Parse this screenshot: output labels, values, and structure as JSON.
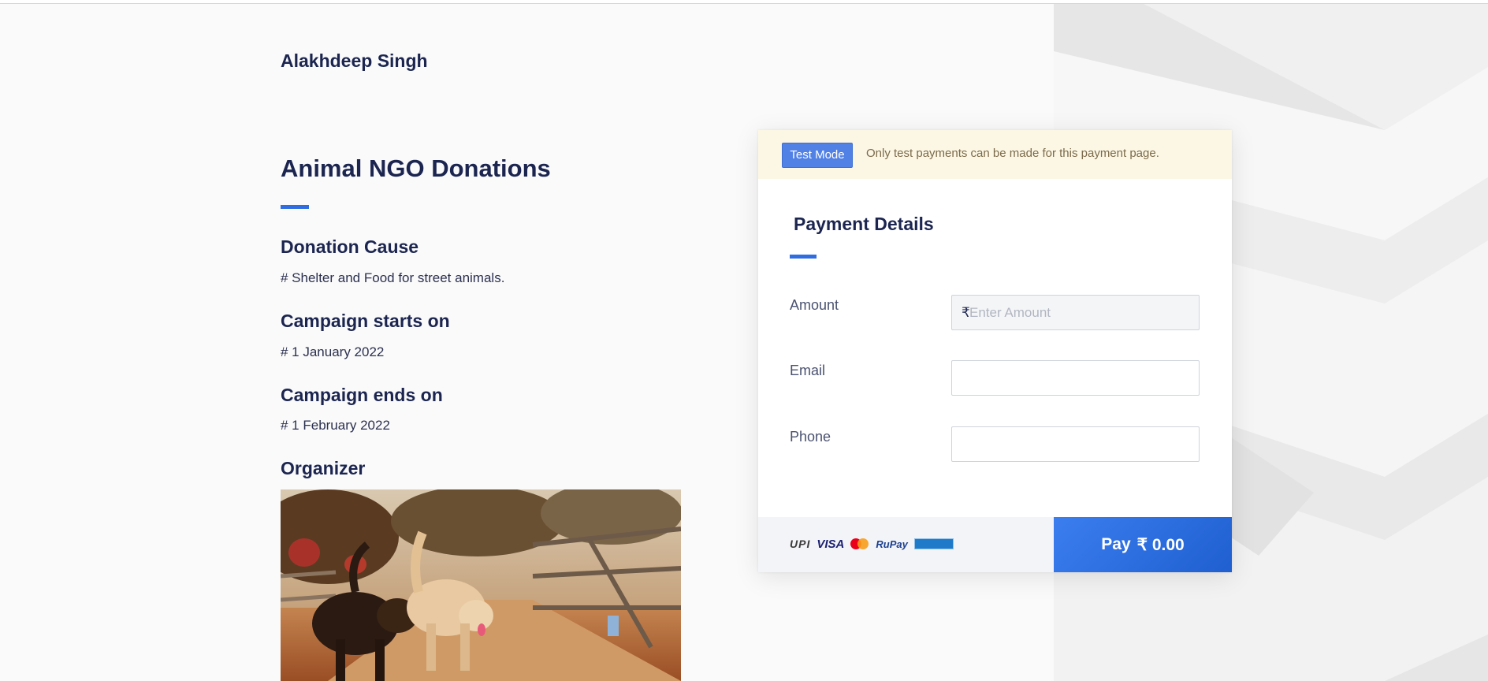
{
  "merchant_name": "Alakhdeep Singh",
  "page_title": "Animal NGO Donations",
  "details": [
    {
      "heading": "Donation Cause",
      "value": "# Shelter and Food for street animals."
    },
    {
      "heading": "Campaign starts on",
      "value": "# 1 January 2022"
    },
    {
      "heading": "Campaign ends on",
      "value": "# 1 February 2022"
    },
    {
      "heading": "Organizer"
    }
  ],
  "test_mode": {
    "badge": "Test Mode",
    "message": "Only test payments can be made for this payment page."
  },
  "payment": {
    "title": "Payment Details",
    "fields": {
      "amount": {
        "label": "Amount",
        "prefix": "₹",
        "placeholder": "Enter Amount",
        "value": ""
      },
      "email": {
        "label": "Email",
        "value": ""
      },
      "phone": {
        "label": "Phone",
        "value": ""
      }
    },
    "accepted_methods": {
      "upi": "UPI",
      "visa": "VISA",
      "rupay": "RuPay"
    },
    "pay_button": {
      "label": "Pay",
      "amount": "₹ 0.00"
    }
  },
  "colors": {
    "accent": "#2f6de0",
    "text_dark": "#1b2550",
    "test_banner_bg": "#fcf7e4",
    "test_badge_bg": "#5281e6",
    "pay_button_bg": "#2a6ee0"
  },
  "icons": [
    "mastercard-icon",
    "pci-compliant-icon"
  ]
}
